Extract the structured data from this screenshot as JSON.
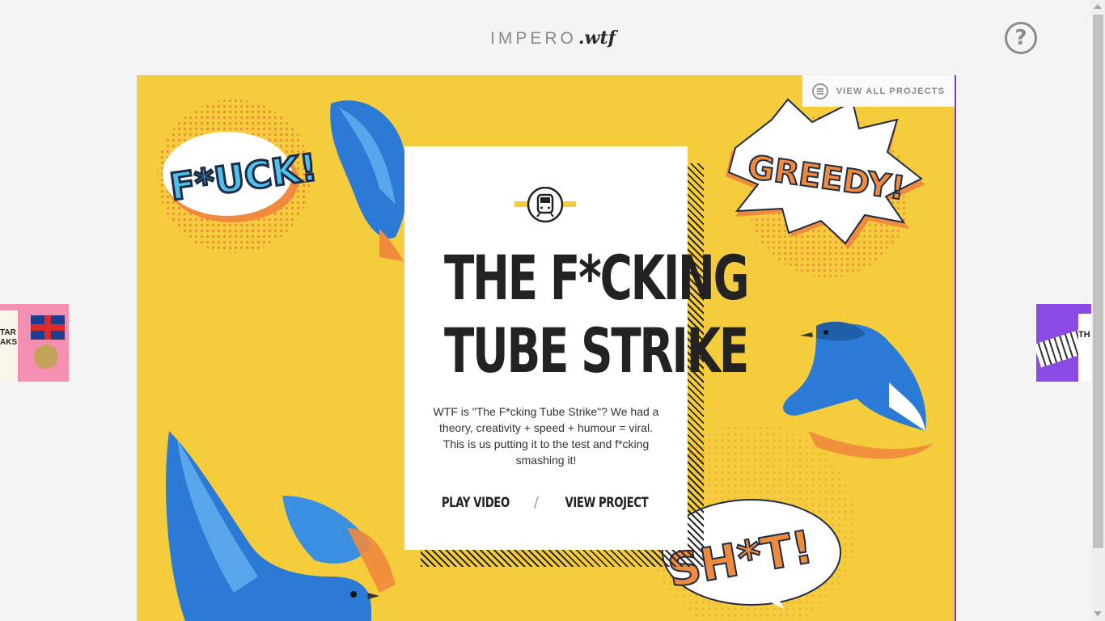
{
  "header": {
    "logo_main": "IMPERO",
    "logo_sub": ".wtf",
    "help_label": "?"
  },
  "stage": {
    "view_all_label": "VIEW ALL PROJECTS",
    "background": "#f5cd3c",
    "stickers": [
      "F*UCK!",
      "GREEDY!",
      "SH*T!"
    ]
  },
  "card": {
    "title_line1": "THE F*CKING",
    "title_line2": "TUBE STRIKE",
    "description": "WTF is \"The F*cking Tube Strike\"? We had a theory, creativity + speed + humour = viral. This is us putting it to the test and f*cking smashing it!",
    "play_label": "PLAY VIDEO",
    "separator": "/",
    "view_label": "VIEW PROJECT"
  },
  "thumbs": {
    "left_text": "TAR AKS",
    "right_text": "TH"
  },
  "colors": {
    "accent_yellow": "#f5cd3c",
    "bird_blue": "#2b7bd6",
    "orange": "#f08a3c",
    "purple": "#8a4ae3",
    "pink": "#f38fb1"
  }
}
